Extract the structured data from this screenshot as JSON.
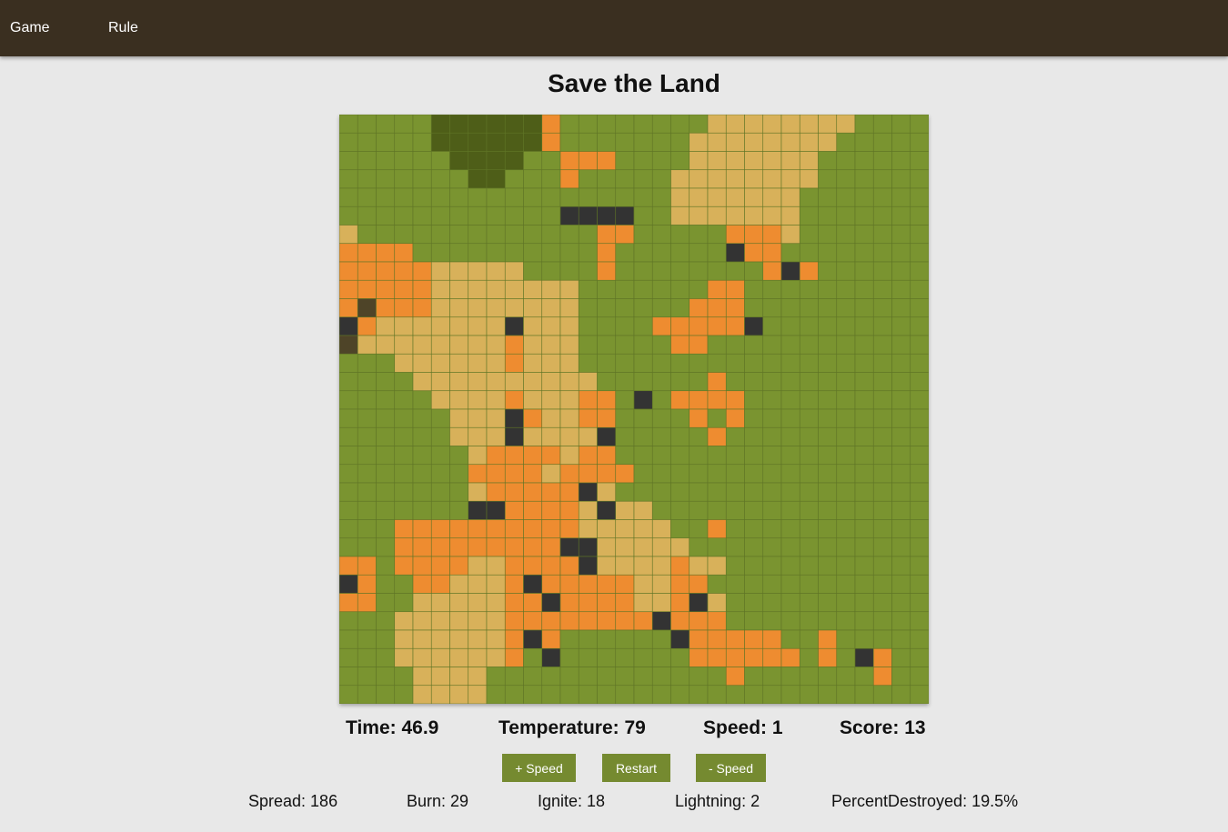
{
  "nav": {
    "items": [
      {
        "label": "Game"
      },
      {
        "label": "Rule"
      }
    ]
  },
  "page": {
    "title": "Save the Land"
  },
  "stats": {
    "time_label": "Time: 46.9",
    "temperature_label": "Temperature: 79",
    "speed_label": "Speed: 1",
    "score_label": "Score: 13"
  },
  "controls": {
    "speed_up_label": "+ Speed",
    "restart_label": "Restart",
    "speed_down_label": "- Speed"
  },
  "info": {
    "spread_label": "Spread: 186",
    "burn_label": "Burn: 29",
    "ignite_label": "Ignite: 18",
    "lightning_label": "Lightning: 2",
    "percent_destroyed_label": "PercentDestroyed: 19.5%"
  },
  "grid": {
    "columns": 32,
    "rows": 32,
    "legend": {
      "G": "grass",
      "F": "forest",
      "B": "burnt",
      "O": "burning",
      "X": "destroyed",
      "A": "ash"
    },
    "colors": {
      "G": "#7a9430",
      "F": "#4e5e18",
      "B": "#d8b15a",
      "O": "#ee8c30",
      "X": "#333333",
      "A": "#4e4428",
      "border": "#5f7526"
    },
    "cells": [
      "GGGGGFFFFFFOGGGGGGGGBBBBBBBBGGGG",
      "GGGGGFFFFFFOGGGGGGGBBBBBBBBGGGGG",
      "GGGGGGFFFFGGOOOGGGGBBBBBBBGGGGGG",
      "GGGGGGGFFGGGOGGGGGBBBBBBBBGGGGGG",
      "GGGGGGGGGGGGGGGGGGBBBBBBBGGGGGGG",
      "GGGGGGGGGGGGXXXXGGBBBBBBBGGGGGGG",
      "BGGGGGGGGGGGGGOOGGGGGOOOBGGGGGGG",
      "OOOOGGGGGGGGGGOGGGGGGXOOGGGGGGGG",
      "OOOOOBBBBBGGGGOGGGGGGGGOXOGGGGGG",
      "OOOOOBBBBBBBBGGGGGGGOOGGGGGGGGGG",
      "OAOOOBBBBBBBBGGGGGGOOOGGGGGGGGGG",
      "XOBBBBBBBXBBBGGGGOOOOOXGGGGGGGGG",
      "ABBBBBBBBOBBBGGGGGOOGGGGGGGGGGGG",
      "GGGBBBBBBOBBBGGGGGGGGGGGGGGGGGGG",
      "GGGGBBBBBBBBBBGGGGGGOGGGGGGGGGGG",
      "GGGGGBBBBOBBBOOGXGOOOOGGGGGGGGGG",
      "GGGGGGBBBXOBBOOGGGGOGOGGGGGGGGGG",
      "GGGGGGBBBXBBBBXGGGGGOGGGGGGGGGGG",
      "GGGGGGGBOOOOBOOGGGGGGGGGGGGGGGGG",
      "GGGGGGGOOOOBOOOOGGGGGGGGGGGGGGGG",
      "GGGGGGGBOOOOOXBGGGGGGGGGGGGGGGGG",
      "GGGGGGGXXOOOOBXBBGGGGGGGGGGGGGGG",
      "GGGOOOOOOOOOOBBBBBGGOGGGGGGGGGGG",
      "GGGOOOOOOOOOXXBBBBBGGGGGGGGGGGGG",
      "OOGOOOOBBOOOOXBBBBOBBGGGGGGGGGGG",
      "XOGGOOBBBOXOOOOOBBOOGGGGGGGGGGGG",
      "OOGGBBBBBOOXOOOOBBOXBGGGGGGGGGGG",
      "GGGBBBBBBOOOOOOOOXOOOGGGGGGGGGGG",
      "GGGBBBBBBOXOGGGGGGXOOOOOGGOGGGGG",
      "GGGBBBBBBOGXGGGGGGGOOOOOOGOGXOGG",
      "GGGGBBBBGGGGGGGGGGGGGOGGGGGGGOGG",
      "GGGGBBBBGGGGGGGGGGGGGGGGGGGGGGGG"
    ]
  }
}
